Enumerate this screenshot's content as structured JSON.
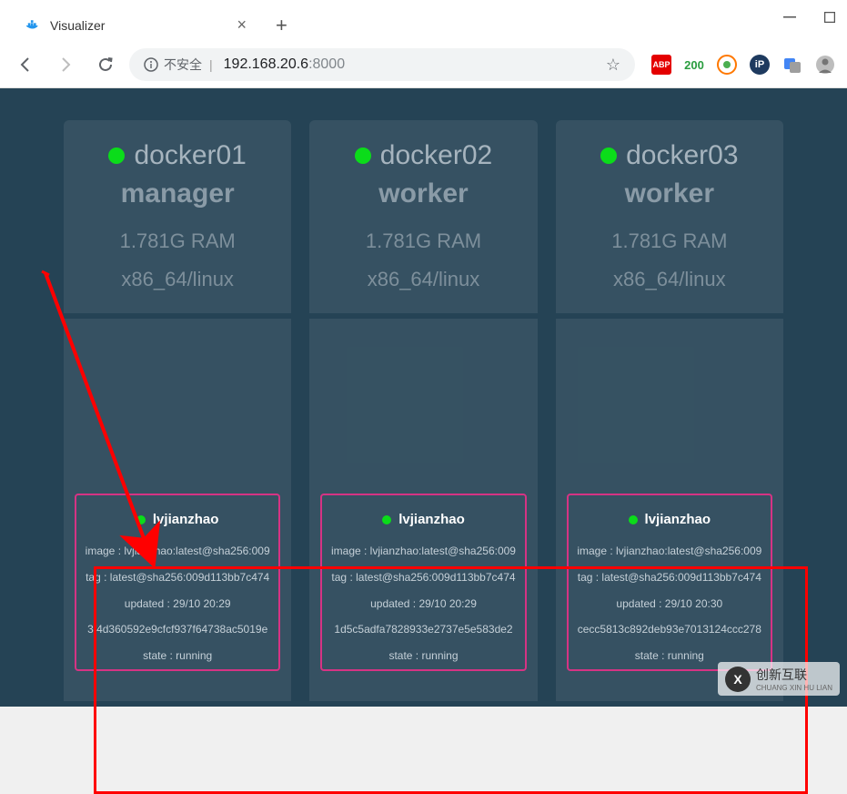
{
  "browser": {
    "tab_title": "Visualizer",
    "not_secure_label": "不安全",
    "url_host": "192.168.20.6",
    "url_port": ":8000",
    "ext_abp": "ABP",
    "ext_count": "200"
  },
  "nodes": [
    {
      "name": "docker01",
      "role": "manager",
      "ram": "1.781G RAM",
      "arch": "x86_64/linux",
      "container": {
        "name": "lvjianzhao",
        "image": "image : lvjianzhao:latest@sha256:009",
        "tag": "tag : latest@sha256:009d113bb7c474",
        "updated": "updated : 29/10 20:29",
        "id": "3f4d360592e9cfcf937f64738ac5019e",
        "state": "state : running"
      }
    },
    {
      "name": "docker02",
      "role": "worker",
      "ram": "1.781G RAM",
      "arch": "x86_64/linux",
      "container": {
        "name": "lvjianzhao",
        "image": "image : lvjianzhao:latest@sha256:009",
        "tag": "tag : latest@sha256:009d113bb7c474",
        "updated": "updated : 29/10 20:29",
        "id": "1d5c5adfa7828933e2737e5e583de2",
        "state": "state : running"
      }
    },
    {
      "name": "docker03",
      "role": "worker",
      "ram": "1.781G RAM",
      "arch": "x86_64/linux",
      "container": {
        "name": "lvjianzhao",
        "image": "image : lvjianzhao:latest@sha256:009",
        "tag": "tag : latest@sha256:009d113bb7c474",
        "updated": "updated : 29/10 20:30",
        "id": "cecc5813c892deb93e7013124ccc278",
        "state": "state : running"
      }
    }
  ],
  "watermark": {
    "text": "创新互联",
    "subtext": "CHUANG XIN HU LIAN"
  }
}
